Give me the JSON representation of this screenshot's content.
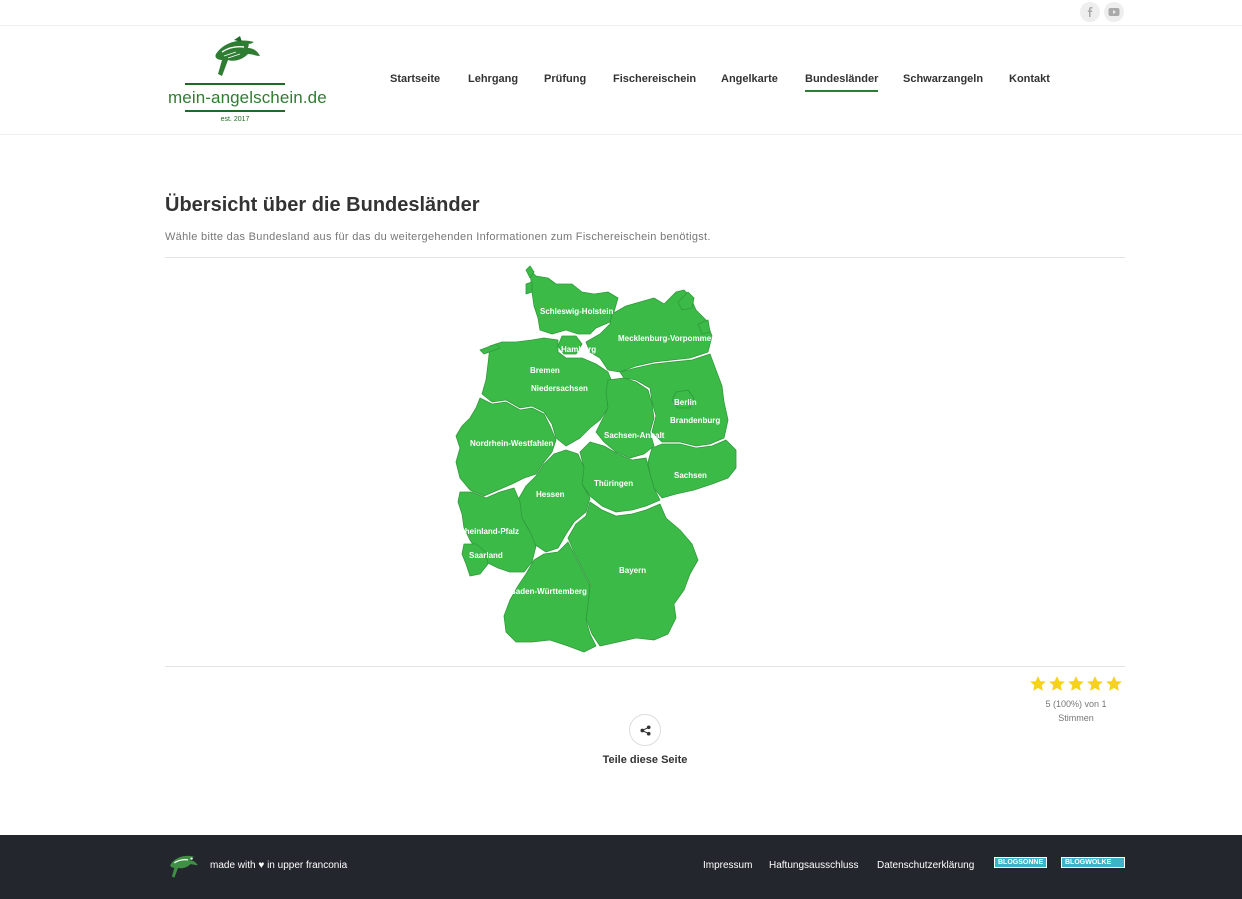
{
  "site": {
    "logo_text": "mein-angelschein.de",
    "logo_est": "est. 2017"
  },
  "social": [
    {
      "name": "facebook",
      "icon": "facebook-icon"
    },
    {
      "name": "youtube",
      "icon": "youtube-icon"
    }
  ],
  "nav": {
    "items": [
      {
        "label": "Startseite"
      },
      {
        "label": "Lehrgang"
      },
      {
        "label": "Prüfung"
      },
      {
        "label": "Fischereischein"
      },
      {
        "label": "Angelkarte"
      },
      {
        "label": "Bundesländer",
        "active": true
      },
      {
        "label": "Schwarzangeln"
      },
      {
        "label": "Kontakt"
      }
    ]
  },
  "page": {
    "title": "Übersicht über die Bundesländer",
    "intro": "Wähle bitte das Bundesland aus für das du weitergehenden Informationen zum Fischereischein benötigst."
  },
  "map": {
    "fill_color": "#3cba48",
    "states": [
      "Schleswig-Holstein",
      "Hamburg",
      "Mecklenburg-Vorpommern",
      "Bremen",
      "Niedersachsen",
      "Berlin",
      "Brandenburg",
      "Sachsen-Anhalt",
      "Nordrhein-Westfahlen",
      "Sachsen",
      "Thüringen",
      "Hessen",
      "Rheinland-Pfalz",
      "Saarland",
      "Bayern",
      "Baden-Württemberg"
    ]
  },
  "rating": {
    "stars": 5,
    "max": 5,
    "text": "5 (100%) von 1 Stimmen",
    "star_color": "#f6d21d"
  },
  "share": {
    "label": "Teile diese Seite",
    "icon": "share-icon"
  },
  "footer": {
    "made_with": "made with ♥ in upper franconia",
    "links": [
      {
        "label": "Impressum"
      },
      {
        "label": "Haftungsausschluss"
      },
      {
        "label": "Datenschutzerklärung"
      }
    ],
    "badges": [
      {
        "label": "BLOGSONNE"
      },
      {
        "label": "BLOGWOLKE"
      }
    ]
  }
}
